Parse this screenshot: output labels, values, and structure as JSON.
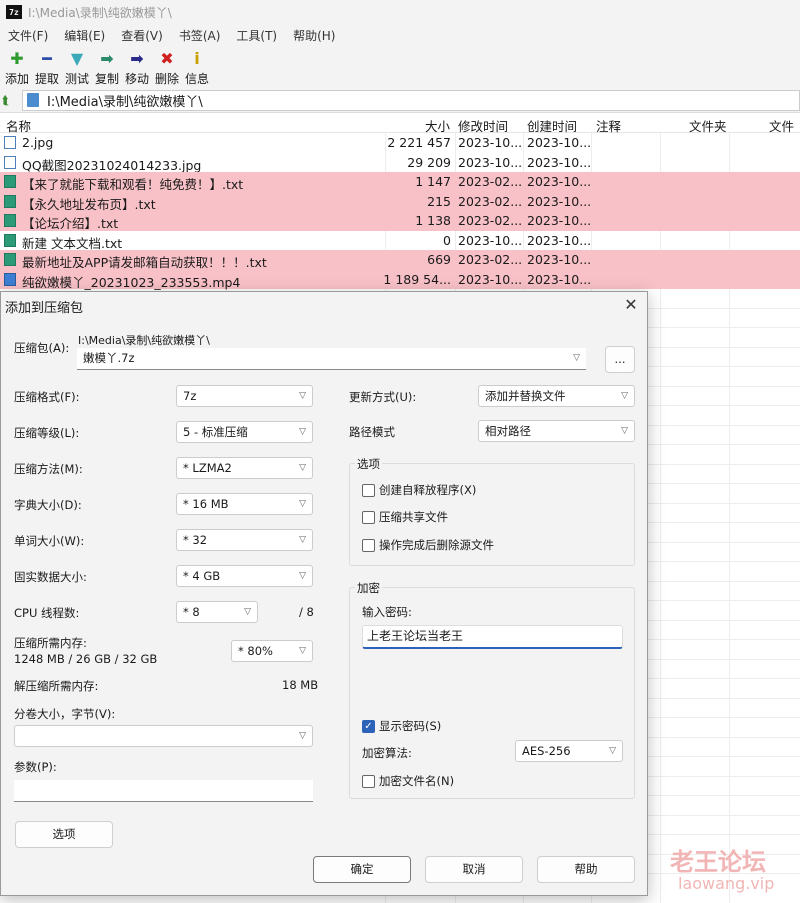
{
  "window": {
    "title": "I:\\Media\\录制\\纯欲嫩模丫\\",
    "app_icon": "7z"
  },
  "menu": [
    "文件(F)",
    "编辑(E)",
    "查看(V)",
    "书签(A)",
    "工具(T)",
    "帮助(H)"
  ],
  "toolbar": [
    {
      "label": "添加",
      "icon": "plus-icon",
      "glyph": "✚",
      "color": "#2d9a2d"
    },
    {
      "label": "提取",
      "icon": "minus-icon",
      "glyph": "━",
      "color": "#2a4aa8"
    },
    {
      "label": "测试",
      "icon": "check-icon",
      "glyph": "▼",
      "color": "#3aaab8"
    },
    {
      "label": "复制",
      "icon": "copy-arrow-icon",
      "glyph": "➡",
      "color": "#2a8a6a"
    },
    {
      "label": "移动",
      "icon": "move-arrow-icon",
      "glyph": "➡",
      "color": "#2a2a8a"
    },
    {
      "label": "删除",
      "icon": "delete-icon",
      "glyph": "✖",
      "color": "#d02020"
    },
    {
      "label": "信息",
      "icon": "info-icon",
      "glyph": "i",
      "color": "#c8a000"
    }
  ],
  "address": {
    "path": "I:\\Media\\录制\\纯欲嫩模丫\\"
  },
  "columns": {
    "name": "名称",
    "size": "大小",
    "modified": "修改时间",
    "created": "创建时间",
    "comment": "注释",
    "folders": "文件夹",
    "files": "文件"
  },
  "files": [
    {
      "name": "2.jpg",
      "size": "2 221 457",
      "modified": "2023-10...",
      "created": "2023-10...",
      "type": "jpg",
      "highlight": false
    },
    {
      "name": "QQ截图20231024014233.jpg",
      "size": "29 209",
      "modified": "2023-10...",
      "created": "2023-10...",
      "type": "jpg",
      "highlight": false
    },
    {
      "name": "【来了就能下载和观看！纯免费！】.txt",
      "size": "1 147",
      "modified": "2023-02...",
      "created": "2023-10...",
      "type": "txt",
      "highlight": true
    },
    {
      "name": "【永久地址发布页】.txt",
      "size": "215",
      "modified": "2023-02...",
      "created": "2023-10...",
      "type": "txt",
      "highlight": true
    },
    {
      "name": "【论坛介绍】.txt",
      "size": "1 138",
      "modified": "2023-02...",
      "created": "2023-10...",
      "type": "txt",
      "highlight": true
    },
    {
      "name": "新建 文本文档.txt",
      "size": "0",
      "modified": "2023-10...",
      "created": "2023-10...",
      "type": "txt",
      "highlight": false
    },
    {
      "name": "最新地址及APP请发邮箱自动获取！！！.txt",
      "size": "669",
      "modified": "2023-02...",
      "created": "2023-10...",
      "type": "txt",
      "highlight": true
    },
    {
      "name": "纯欲嫩模丫_20231023_233553.mp4",
      "size": "1 189 54...",
      "modified": "2023-10...",
      "created": "2023-10...",
      "type": "mp4",
      "highlight": true
    }
  ],
  "dialog": {
    "title": "添加到压缩包",
    "archive_label": "压缩包(A):",
    "archive_dir": "I:\\Media\\录制\\纯欲嫩模丫\\",
    "archive_name": "嫩模丫.7z",
    "browse_label": "...",
    "format_label": "压缩格式(F):",
    "format_value": "7z",
    "level_label": "压缩等级(L):",
    "level_value": "5 - 标准压缩",
    "method_label": "压缩方法(M):",
    "method_value": "*  LZMA2",
    "dict_label": "字典大小(D):",
    "dict_value": "*  16 MB",
    "word_label": "单词大小(W):",
    "word_value": "*  32",
    "solid_label": "固实数据大小:",
    "solid_value": "*  4 GB",
    "threads_label": "CPU 线程数:",
    "threads_value": "*  8",
    "threads_max": "/ 8",
    "mem_comp_label": "压缩所需内存:",
    "mem_comp_value": "1248 MB / 26 GB / 32 GB",
    "mem_percent": "* 80%",
    "mem_decomp_label": "解压缩所需内存:",
    "mem_decomp_value": "18 MB",
    "split_label": "分卷大小，字节(V):",
    "params_label": "参数(P):",
    "options_button": "选项",
    "update_label": "更新方式(U):",
    "update_value": "添加并替换文件",
    "pathmode_label": "路径模式",
    "pathmode_value": "相对路径",
    "options_group": "选项",
    "opt_sfx": "创建自释放程序(X)",
    "opt_shared": "压缩共享文件",
    "opt_delete": "操作完成后删除源文件",
    "encrypt_group": "加密",
    "password_label": "输入密码:",
    "password_value": "上老王论坛当老王",
    "show_password": "显示密码(S)",
    "enc_method_label": "加密算法:",
    "enc_method_value": "AES-256",
    "encrypt_names": "加密文件名(N)",
    "ok": "确定",
    "cancel": "取消",
    "help": "帮助"
  },
  "watermark": {
    "cn": "老王论坛",
    "en": "laowang.vip"
  }
}
